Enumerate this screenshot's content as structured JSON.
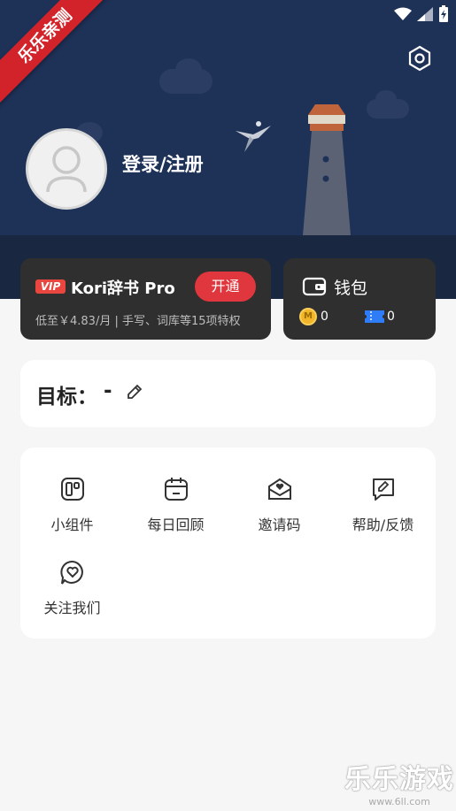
{
  "ribbon": {
    "text": "乐乐亲测"
  },
  "user": {
    "login_label": "登录/注册"
  },
  "vip": {
    "badge": "VIP",
    "title": "Kori辞书 Pro",
    "open_button": "开通",
    "subtitle": "低至￥4.83/月 | 手写、词库等15项特权"
  },
  "wallet": {
    "title": "钱包",
    "coin_count": "0",
    "ticket_count": "0",
    "coin_letter": "M"
  },
  "goal": {
    "label": "目标：",
    "value": "-"
  },
  "tools": [
    {
      "label": "小组件",
      "icon": "widget-icon"
    },
    {
      "label": "每日回顾",
      "icon": "calendar-icon"
    },
    {
      "label": "邀请码",
      "icon": "invite-mail-icon"
    },
    {
      "label": "帮助/反馈",
      "icon": "feedback-edit-icon"
    },
    {
      "label": "关注我们",
      "icon": "heart-chat-icon"
    }
  ],
  "watermark": {
    "big": "乐乐游戏",
    "small": "www.6ll.com"
  },
  "colors": {
    "hero_bg": "#1e3157",
    "accent_red": "#e0363d",
    "card_dark": "#2f2f2f"
  }
}
